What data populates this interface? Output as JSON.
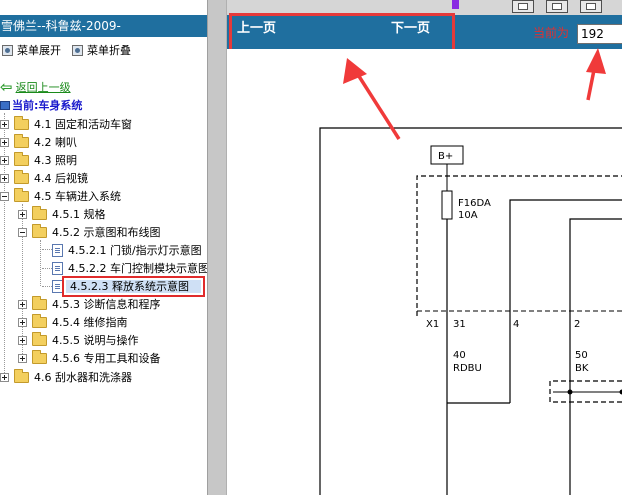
{
  "sidebar": {
    "title": "雪佛兰--科鲁兹-2009-",
    "expand_all": "菜单展开",
    "collapse_all": "菜单折叠",
    "back": "返回上一级",
    "current": "当前:车身系统",
    "tree": [
      {
        "label": "4.1 固定和活动车窗",
        "state": "plus"
      },
      {
        "label": "4.2 喇叭",
        "state": "plus"
      },
      {
        "label": "4.3 照明",
        "state": "plus"
      },
      {
        "label": "4.4 后视镜",
        "state": "plus"
      },
      {
        "label": "4.5 车辆进入系统",
        "state": "minus"
      },
      {
        "label": "4.5.1 规格",
        "state": "plus"
      },
      {
        "label": "4.5.2 示意图和布线图",
        "state": "minus"
      },
      {
        "label": "4.5.2.1 门锁/指示灯示意图",
        "state": "doc"
      },
      {
        "label": "4.5.2.2 车门控制模块示意图",
        "state": "doc"
      },
      {
        "label": "4.5.2.3 释放系统示意图",
        "state": "selected"
      },
      {
        "label": "4.5.3 诊断信息和程序",
        "state": "plus"
      },
      {
        "label": "4.5.4 维修指南",
        "state": "plus"
      },
      {
        "label": "4.5.5 说明与操作",
        "state": "plus"
      },
      {
        "label": "4.5.6 专用工具和设备",
        "state": "plus"
      },
      {
        "label": "4.6 刮水器和洗涤器",
        "state": "plus"
      }
    ]
  },
  "viewer": {
    "prev": "上一页",
    "next": "下一页",
    "current_label": "当前为",
    "page_value": "192"
  },
  "diagram": {
    "bplus": "B+",
    "fuse_name": "F16DA",
    "fuse_rating": "10A",
    "connector": "X1",
    "pin_31": "31",
    "pin_4": "4",
    "pin_2": "2",
    "wire1_size": "40",
    "wire1_color": "RDBU",
    "wire2_size": "50",
    "wire2_color": "BK"
  },
  "colors": {
    "header_blue": "#1f6f9f",
    "highlight_red": "#e53a3a",
    "link_green": "#1a8a1a",
    "current_blue": "#1a1acc"
  }
}
